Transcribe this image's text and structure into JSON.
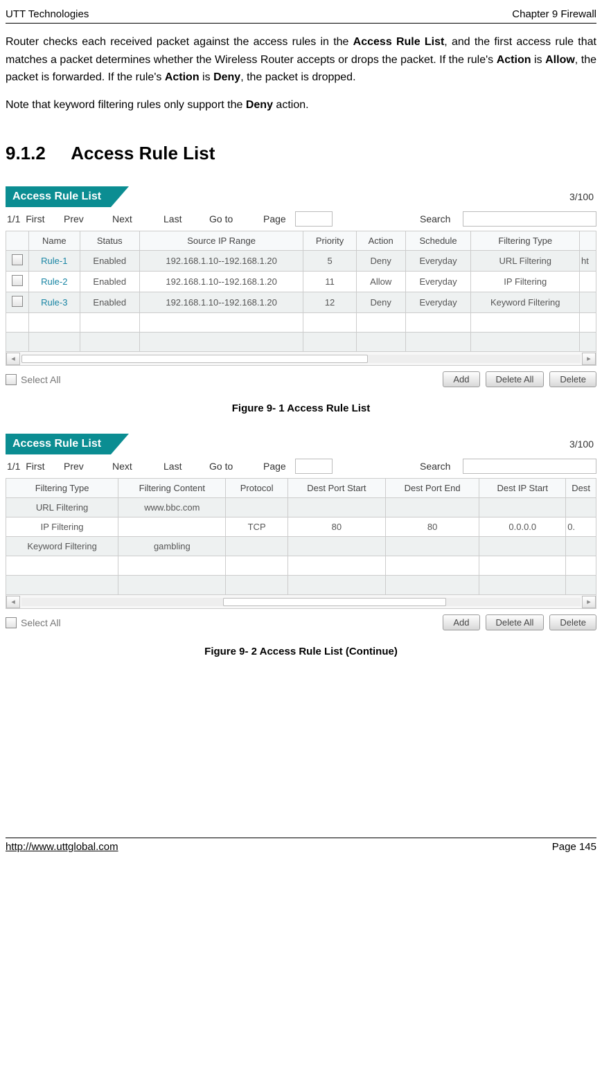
{
  "header": {
    "left": "UTT Technologies",
    "right": "Chapter 9 Firewall"
  },
  "para1": {
    "seg1": "Router checks each received packet against the access rules in the ",
    "bold1": "Access Rule List",
    "seg2": ", and the first access rule that matches a packet determines whether the Wireless Router accepts or drops the packet. If the rule's ",
    "bold2": "Action",
    "seg3": " is ",
    "bold3": "Allow",
    "seg4": ", the packet is forwarded. If the rule's ",
    "bold4": "Action",
    "seg5": " is ",
    "bold5": "Deny",
    "seg6": ", the packet is dropped."
  },
  "para2": {
    "seg1": "Note that keyword filtering rules only support the ",
    "bold1": "Deny",
    "seg2": " action."
  },
  "section": {
    "num": "9.1.2",
    "title": "Access Rule List"
  },
  "panel1": {
    "tab_label": "Access Rule List",
    "count": "3/100",
    "pager": {
      "ratio": "1/1",
      "first": "First",
      "prev": "Prev",
      "next": "Next",
      "last": "Last",
      "goto": "Go to",
      "page": "Page",
      "search": "Search"
    },
    "headers": [
      "",
      "Name",
      "Status",
      "Source IP Range",
      "Priority",
      "Action",
      "Schedule",
      "Filtering Type",
      ""
    ],
    "rows": [
      {
        "name": "Rule-1",
        "status": "Enabled",
        "src": "192.168.1.10--192.168.1.20",
        "prio": "5",
        "action": "Deny",
        "sched": "Everyday",
        "ftype": "URL Filtering",
        "cut": "ht"
      },
      {
        "name": "Rule-2",
        "status": "Enabled",
        "src": "192.168.1.10--192.168.1.20",
        "prio": "11",
        "action": "Allow",
        "sched": "Everyday",
        "ftype": "IP Filtering",
        "cut": ""
      },
      {
        "name": "Rule-3",
        "status": "Enabled",
        "src": "192.168.1.10--192.168.1.20",
        "prio": "12",
        "action": "Deny",
        "sched": "Everyday",
        "ftype": "Keyword Filtering",
        "cut": ""
      }
    ],
    "actions": {
      "select_all": "Select All",
      "add": "Add",
      "delete_all": "Delete All",
      "delete": "Delete"
    }
  },
  "caption1": "Figure 9- 1 Access Rule List",
  "panel2": {
    "tab_label": "Access Rule List",
    "count": "3/100",
    "pager": {
      "ratio": "1/1",
      "first": "First",
      "prev": "Prev",
      "next": "Next",
      "last": "Last",
      "goto": "Go to",
      "page": "Page",
      "search": "Search"
    },
    "headers": [
      "Filtering Type",
      "Filtering Content",
      "Protocol",
      "Dest Port Start",
      "Dest Port End",
      "Dest IP Start",
      "Dest"
    ],
    "rows": [
      {
        "ftype": "URL Filtering",
        "fcontent": "www.bbc.com",
        "proto": "",
        "dps": "",
        "dpe": "",
        "dips": "",
        "cut": ""
      },
      {
        "ftype": "IP Filtering",
        "fcontent": "",
        "proto": "TCP",
        "dps": "80",
        "dpe": "80",
        "dips": "0.0.0.0",
        "cut": "0."
      },
      {
        "ftype": "Keyword Filtering",
        "fcontent": "gambling",
        "proto": "",
        "dps": "",
        "dpe": "",
        "dips": "",
        "cut": ""
      }
    ],
    "actions": {
      "select_all": "Select All",
      "add": "Add",
      "delete_all": "Delete All",
      "delete": "Delete"
    }
  },
  "caption2": "Figure 9- 2 Access Rule List (Continue)",
  "footer": {
    "url": "http://www.uttglobal.com",
    "page": "Page 145"
  }
}
